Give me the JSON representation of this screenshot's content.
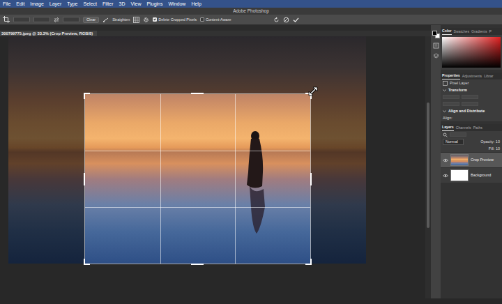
{
  "menu_bar": {
    "items": [
      "File",
      "Edit",
      "Image",
      "Layer",
      "Type",
      "Select",
      "Filter",
      "3D",
      "View",
      "Plugins",
      "Window",
      "Help"
    ]
  },
  "window": {
    "title": "Adobe Photoshop"
  },
  "options_bar": {
    "clear": "Clear",
    "straighten": "Straighten",
    "checkboxes": [
      {
        "label": "Delete Cropped Pixels",
        "checked": true
      },
      {
        "label": "Content-Aware",
        "checked": false
      }
    ]
  },
  "document": {
    "tab": "300799775.jpeg @ 33.3% (Crop Preview, RGB/8)"
  },
  "color_panel": {
    "tabs": [
      {
        "label": "Color",
        "selected": true
      },
      {
        "label": "Swatches",
        "selected": false
      },
      {
        "label": "Gradients",
        "selected": false
      },
      {
        "label": "P",
        "selected": false
      }
    ]
  },
  "properties_panel": {
    "tabs": [
      {
        "label": "Properties",
        "selected": true
      },
      {
        "label": "Adjustments",
        "selected": false
      },
      {
        "label": "Librar",
        "selected": false
      }
    ],
    "layer_kind": "Pixel Layer",
    "transform": "Transform",
    "align_section": "Align and Distribute",
    "align_label": "Align:"
  },
  "layers_panel": {
    "tabs": [
      {
        "label": "Layers",
        "selected": true
      },
      {
        "label": "Channels",
        "selected": false
      },
      {
        "label": "Paths",
        "selected": false
      }
    ],
    "blend_mode": "Normal",
    "opacity": "Opacity: 10",
    "fill": "Fill: 10",
    "layers": [
      {
        "name": "Crop Preview",
        "visible": true,
        "selected": true
      },
      {
        "name": "Background",
        "visible": true,
        "selected": false
      }
    ]
  }
}
